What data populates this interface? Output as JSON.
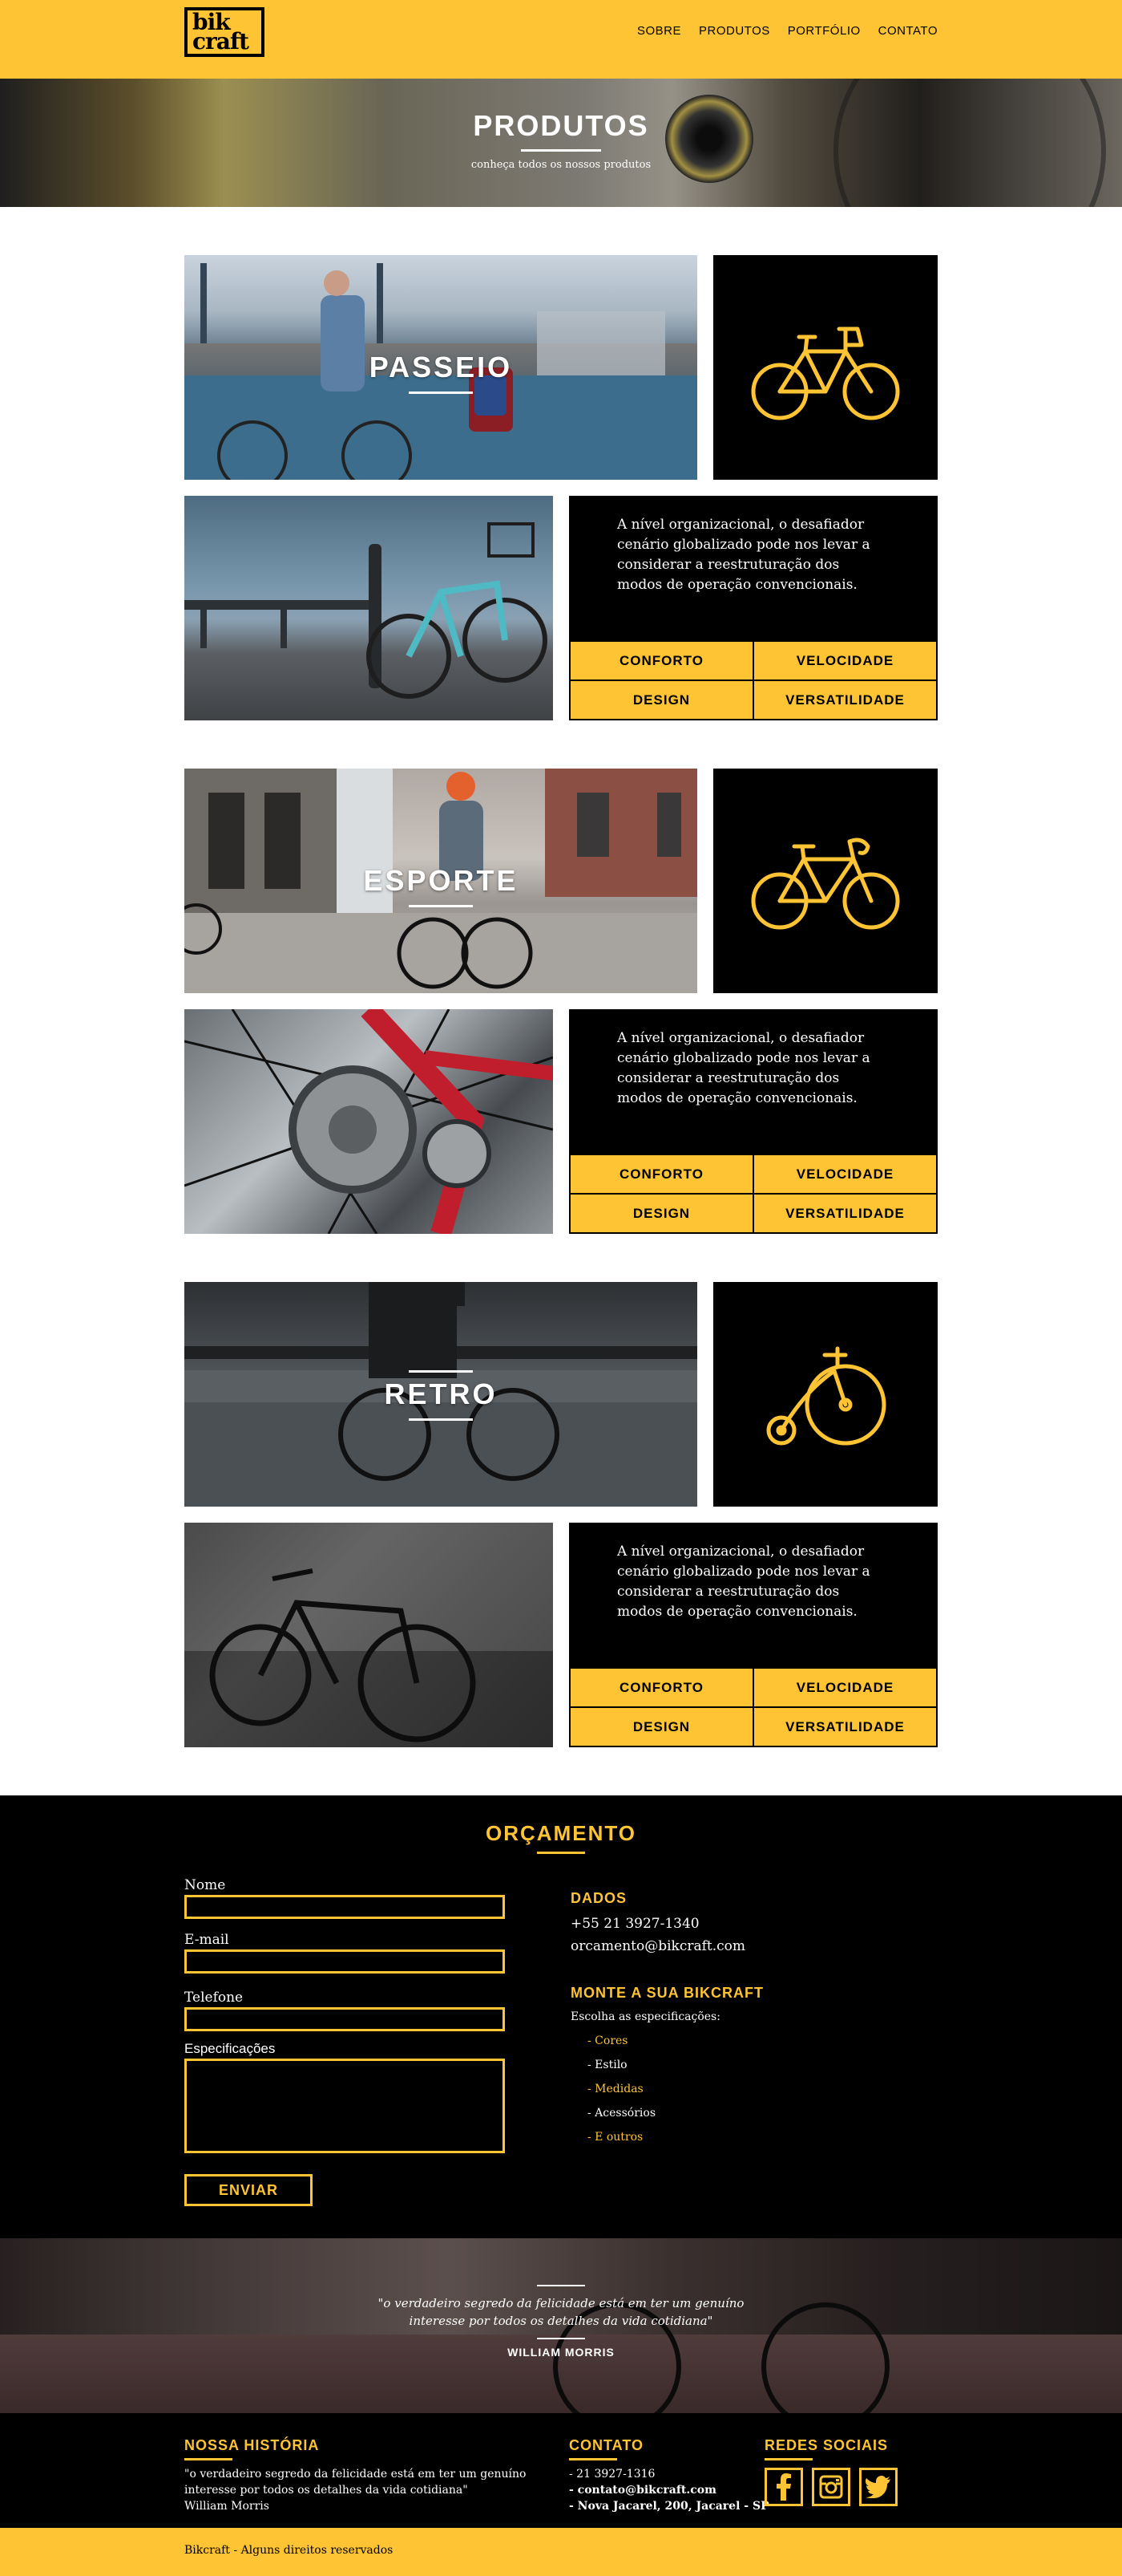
{
  "header": {
    "logo_line1": "bik",
    "logo_line2": "craft",
    "nav": [
      "SOBRE",
      "PRODUTOS",
      "PORTFÓLIO",
      "CONTATO"
    ]
  },
  "hero": {
    "title": "PRODUTOS",
    "subtitle": "conheça todos os nossos produtos"
  },
  "products": [
    {
      "name": "PASSEIO",
      "icon": "city-bike-icon",
      "description": "A nível organizacional, o desafiador cenário globalizado pode nos levar a considerar a reestruturação dos modos de operação convencionais.",
      "features": [
        "CONFORTO",
        "VELOCIDADE",
        "DESIGN",
        "VERSATILIDADE"
      ]
    },
    {
      "name": "ESPORTE",
      "icon": "sport-bike-icon",
      "description": "A nível organizacional, o desafiador cenário globalizado pode nos levar a considerar a reestruturação dos modos de operação convencionais.",
      "features": [
        "CONFORTO",
        "VELOCIDADE",
        "DESIGN",
        "VERSATILIDADE"
      ]
    },
    {
      "name": "RETRO",
      "icon": "penny-farthing-icon",
      "description": "A nível organizacional, o desafiador cenário globalizado pode nos levar a considerar a reestruturação dos modos de operação convencionais.",
      "features": [
        "CONFORTO",
        "VELOCIDADE",
        "DESIGN",
        "VERSATILIDADE"
      ]
    }
  ],
  "orcamento": {
    "title": "ORÇAMENTO",
    "form": {
      "nome_label": "Nome",
      "email_label": "E-mail",
      "telefone_label": "Telefone",
      "especificacoes_label": "Especificações",
      "send_label": "ENVIAR"
    },
    "dados": {
      "title": "DADOS",
      "phone": "+55 21 3927-1340",
      "email": "orcamento@bikcraft.com"
    },
    "monte": {
      "title": "MONTE A SUA BIKCRAFT",
      "intro": "Escolha as especificações:",
      "items": [
        {
          "label": "- Cores",
          "color": "#FEC433"
        },
        {
          "label": "- Estilo",
          "color": "#FFFFFF"
        },
        {
          "label": "- Medidas",
          "color": "#FEC433"
        },
        {
          "label": "- Acessórios",
          "color": "#FFFFFF"
        },
        {
          "label": "- E outros",
          "color": "#FEC433"
        }
      ]
    }
  },
  "quote": {
    "line1": "\"o verdadeiro segredo da felicidade está em ter um genuíno",
    "line2": "interesse por todos os detalhes da vida cotidiana\"",
    "author": "WILLIAM MORRIS"
  },
  "footer": {
    "historia": {
      "title": "NOSSA HISTÓRIA",
      "line1": "\"o verdadeiro segredo da felicidade está em ter um genuíno",
      "line2": "interesse por todos os detalhes da vida cotidiana\"",
      "author": "William Morris"
    },
    "contato": {
      "title": "CONTATO",
      "phone": "- 21 3927-1316",
      "email": "- contato@bikcraft.com",
      "address": "- Nova Jacarel, 200, Jacarel - SP"
    },
    "redes": {
      "title": "REDES SOCIAIS",
      "icons": [
        "facebook-icon",
        "instagram-icon",
        "twitter-icon"
      ]
    },
    "copyright": "Bikcraft - Alguns direitos reservados"
  },
  "colors": {
    "accent": "#FEC433",
    "dark": "#000000"
  }
}
